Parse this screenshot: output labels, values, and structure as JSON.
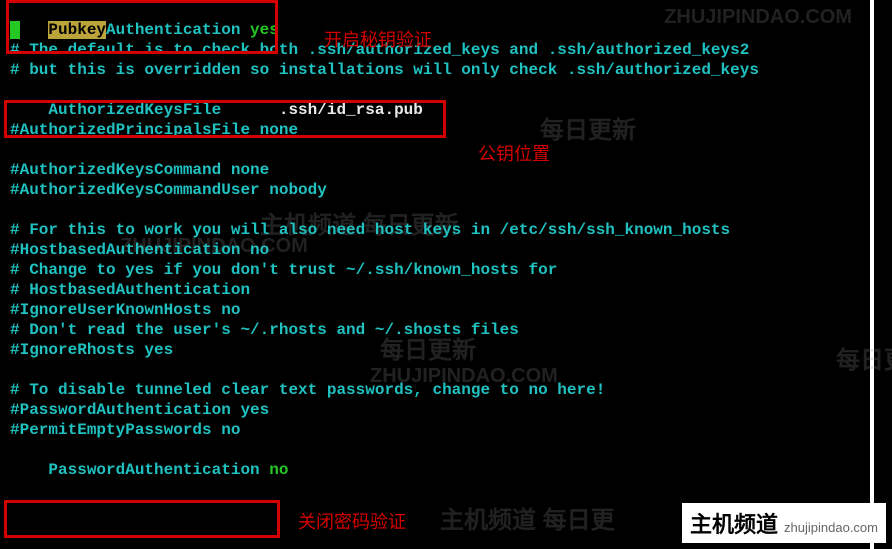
{
  "lines": {
    "l1_key": "Pubkey",
    "l1_key2": "Authentication",
    "l1_val": "yes",
    "l2_cursor": "",
    "l3": "# The default is to check both .ssh/authorized_keys and .ssh/authorized_keys2",
    "l4": "# but this is overridden so installations will only check .ssh/authorized_keys",
    "l5_key": "AuthorizedKeysFile",
    "l5_sp": "      ",
    "l5_val": ".ssh/id_rsa.pub",
    "l7": "#AuthorizedPrincipalsFile none",
    "l9": "#AuthorizedKeysCommand none",
    "l10": "#AuthorizedKeysCommandUser nobody",
    "l12": "# For this to work you will also need host keys in /etc/ssh/ssh_known_hosts",
    "l13": "#HostbasedAuthentication no",
    "l14": "# Change to yes if you don't trust ~/.ssh/known_hosts for",
    "l15": "# HostbasedAuthentication",
    "l16": "#IgnoreUserKnownHosts no",
    "l17": "# Don't read the user's ~/.rhosts and ~/.shosts files",
    "l18": "#IgnoreRhosts yes",
    "l20": "# To disable tunneled clear text passwords, change to no here!",
    "l21": "#PasswordAuthentication yes",
    "l22": "#PermitEmptyPasswords no",
    "l23_key": "PasswordAuthentication",
    "l23_val": "no"
  },
  "annot": {
    "a1": "开启秘钥验证",
    "a2": "公钥位置",
    "a3": "关闭密码验证"
  },
  "wm": {
    "w1": "主机频道 每日更新",
    "w2": "ZHUJIPINDAO.COM",
    "w3": "每日更新",
    "w4": "主机频道 每日更",
    "w5": "主机频道 每日更新"
  },
  "brand": {
    "name": "主机频道",
    "url": "zhujipindao.com"
  }
}
